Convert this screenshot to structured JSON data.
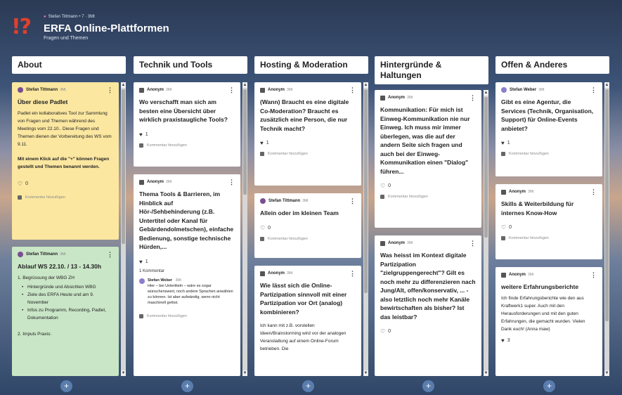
{
  "header": {
    "meta_author": "Stefan Tittmann",
    "meta_likes": "7",
    "meta_time": "3Mt",
    "title": "ERFA Online-Plattformen",
    "subtitle": "Fragen und Themen",
    "logo": "!?"
  },
  "columns": [
    {
      "title": "About",
      "cards": [
        {
          "author": "Stefan Tittmann",
          "time": "3Mt.",
          "title": "Über diese Padlet",
          "body1": "Padlet ein kollaboratives Tool zur Sammlung von Fragen und Themen während des Meetings vom 22.10.. Diese Fragen und Themen dienen der Vorbereitung des WS vom 9.11.",
          "body2": "Mit einem Klick auf die \"+\" können Fragen gestellt und Themen benannt werden.",
          "likes": "0",
          "comment_placeholder": "Kommentar hinzufügen"
        },
        {
          "author": "Stefan Tittmann",
          "time": "3Mt.",
          "title": "Ablauf WS 22.10. / 13 - 14.30h",
          "item1": "1. Begrüssung der WBG ZH",
          "bullets": [
            "Hintergründe und  Absichten WBG",
            "Ziele des ERFA Heute und am 9. November",
            "Infos zu Programm, Recording, Padlet, Dokumentation"
          ],
          "item2": "2. Impuls Praxis:"
        }
      ]
    },
    {
      "title": "Technik und Tools",
      "cards": [
        {
          "author": "Anonym",
          "time": "3Mt",
          "title": "Wo verschafft man sich am besten eine Übersicht über wirklich praxistaugliche Tools?",
          "likes": "1",
          "comment_placeholder": "Kommentar hinzufügen"
        },
        {
          "author": "Anonym",
          "time": "3Mt",
          "title": "Thema Tools & Barrieren, im Hinblick auf Hör-/Sehbehinderung (z.B. Untertitel oder Kanal für Gebärdendolmetschen), einfache Bedienung, sonstige technische Hürden,...",
          "likes": "1",
          "comment_count": "1 Kommentar",
          "reply_author": "Stefan Weber",
          "reply_time": "3Mt",
          "reply_text": "Hier – bei Untertiteln – wäre es sogar wünschenswert, noch andere Sprachen anwählen zu können. Ist aber aufwändig, wenn nicht maschinell gelöst.",
          "comment_placeholder": "Kommentar hinzufügen"
        }
      ]
    },
    {
      "title": "Hosting & Moderation",
      "cards": [
        {
          "author": "Anonym",
          "time": "3Mt",
          "title": "(Wann) Braucht es eine digitale Co-Moderation? Braucht es zusätzlich eine Person, die nur Technik macht?",
          "likes": "1",
          "comment_placeholder": "Kommentar hinzufügen"
        },
        {
          "author": "Stefan Tittmann",
          "time": "3Mt",
          "title": "Allein oder im kleinen Team",
          "likes": "0",
          "comment_placeholder": "Kommentar hinzufügen"
        },
        {
          "author": "Anonym",
          "time": "3Mt",
          "title": "Wie lässt sich die Online-Partizipation sinnvoll mit einer Partizipation vor Ort (analog) kombinieren?",
          "body": "Ich kann mit z.B. vorstellen Ideen/Brainstorming wird vor der analogen Veranstaltung auf einem Online-Forum betrieben. Die"
        }
      ]
    },
    {
      "title": "Hintergründe & Haltungen",
      "cards": [
        {
          "author": "Anonym",
          "time": "3Mt",
          "title": "Kommunikation: Für mich ist Einweg-Kommunikation nie nur Einweg. Ich muss mir immer überlegen, was die auf der andern Seite sich fragen und auch bei der Einweg-Kommunikation einen \"Dialog\" führen...",
          "likes": "0",
          "comment_placeholder": "Kommentar hinzufügen"
        },
        {
          "author": "Anonym",
          "time": "3Mt",
          "title": "Was heisst im Kontext digitale Partizipation \"zielgruppengerecht\"? Gilt es noch mehr zu differenzieren nach Jung/Alt, offen/konservativ, ... - also letztlich noch mehr Kanäle bewirtschaften als bisher? Ist das leistbar?",
          "likes": "0"
        }
      ]
    },
    {
      "title": "Offen & Anderes",
      "cards": [
        {
          "author": "Stefan Weber",
          "time": "3Mt",
          "title": "Gibt es eine Agentur, die Services (Technik, Organisation, Support) für Online-Events anbietet?",
          "likes": "1",
          "comment_placeholder": "Kommentar hinzufügen"
        },
        {
          "author": "Anonym",
          "time": "3Mt",
          "title": "Skills & Weiterbildung für internes Know-How",
          "likes": "0",
          "comment_placeholder": "Kommentar hinzufügen"
        },
        {
          "author": "Anonym",
          "time": "3Mt",
          "title": "weitere Erfahrungsberichte",
          "body": "Ich finde Erfahrungsberichte wie den aus Kraftwerk1 super. Auch mit den Herausforderungen und mit den guten Erfahrungen, die gemacht wurden. Vielen Dank euch! (Anna maw)",
          "likes": "3"
        }
      ]
    }
  ],
  "add_label": "+",
  "icons": {
    "heart_filled": "♥",
    "heart_outline": "♡",
    "more": "⋮",
    "scroll_up": "▲",
    "scroll_down": "▼"
  },
  "colors": {
    "logo": "#e0402c",
    "yellow_card": "#fbe7a0",
    "green_card": "#c9e6c6",
    "add_button": "#5a7dae"
  }
}
